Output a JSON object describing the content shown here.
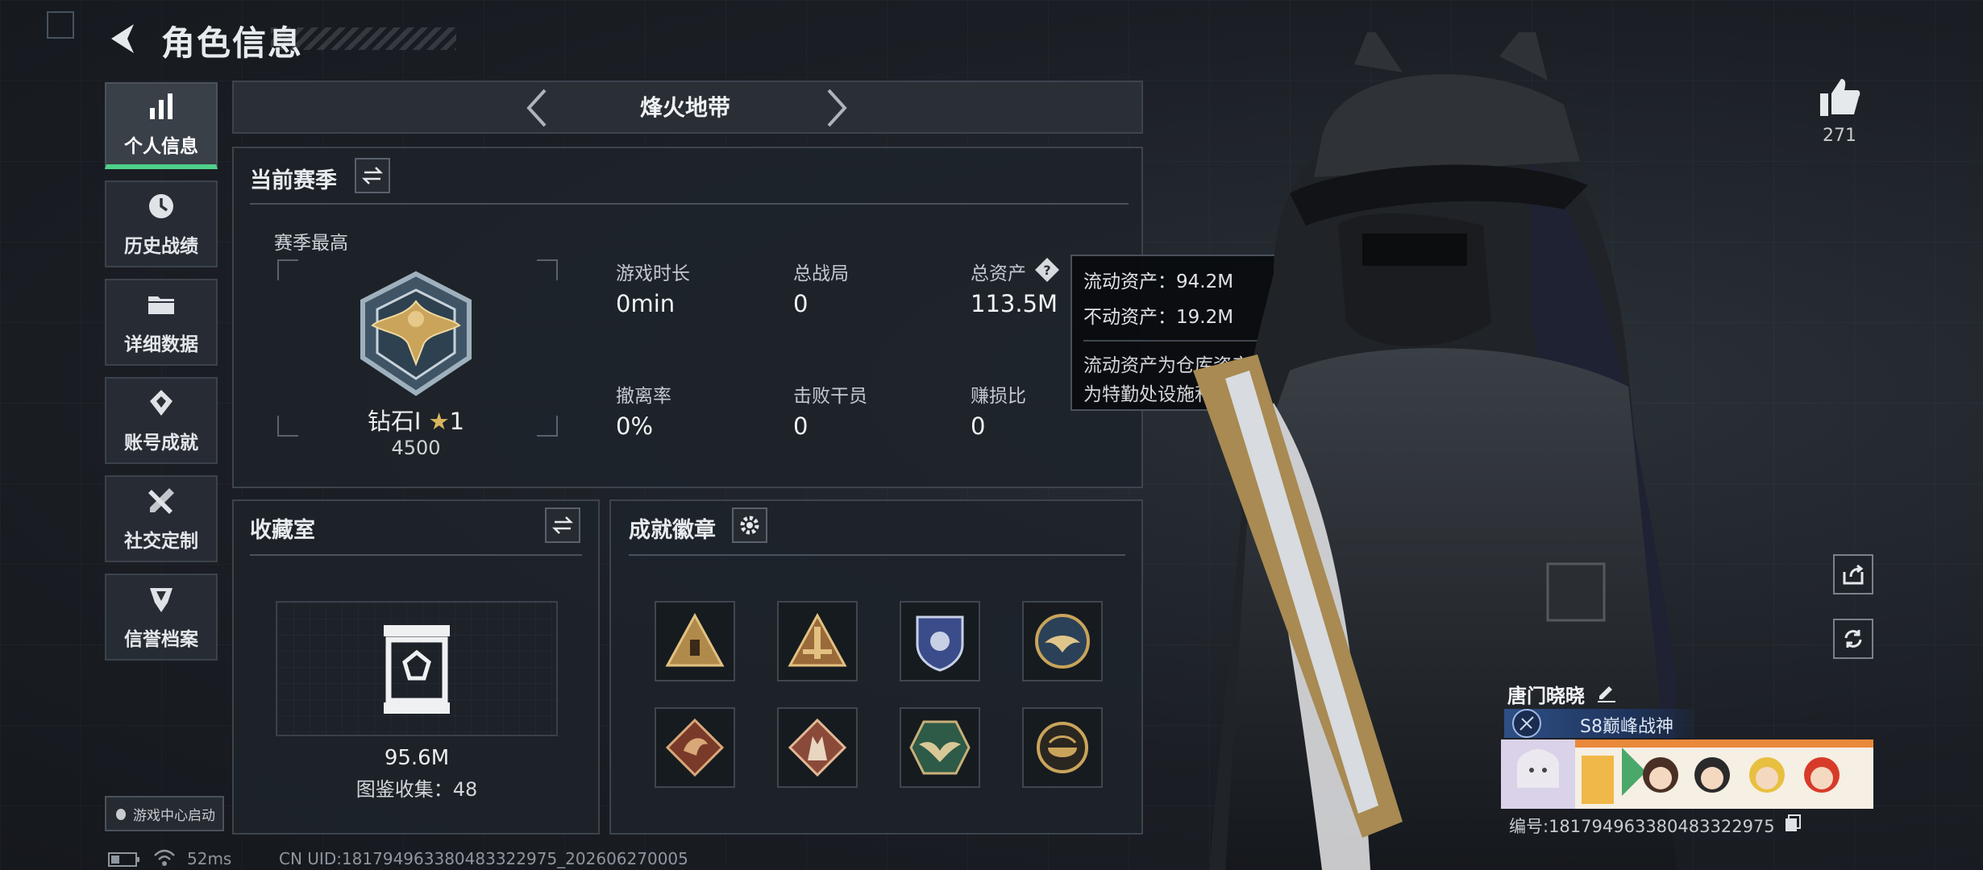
{
  "header": {
    "title": "角色信息"
  },
  "sidebar": {
    "items": [
      {
        "label": "个人信息",
        "icon": "bar-chart-icon",
        "active": true
      },
      {
        "label": "历史战绩",
        "icon": "history-icon"
      },
      {
        "label": "详细数据",
        "icon": "folder-icon"
      },
      {
        "label": "账号成就",
        "icon": "achievement-icon"
      },
      {
        "label": "社交定制",
        "icon": "tools-icon"
      },
      {
        "label": "信誉档案",
        "icon": "reputation-icon"
      }
    ],
    "game_center": "游戏中心启动"
  },
  "mode_tab": {
    "title": "烽火地带"
  },
  "season": {
    "title": "当前赛季",
    "best_label": "赛季最高",
    "rank_name": "钻石Ⅰ",
    "rank_stars": "1",
    "rank_points": "4500",
    "stats": [
      {
        "label": "游戏时长",
        "value": "0min"
      },
      {
        "label": "总战局",
        "value": "0"
      },
      {
        "label": "总资产",
        "value": "113.5M"
      },
      {
        "label": "撤离率",
        "value": "0%"
      },
      {
        "label": "击败干员",
        "value": "0"
      },
      {
        "label": "赚损比",
        "value": "0"
      }
    ]
  },
  "tooltip": {
    "liquid": "流动资产：94.2M",
    "fixed": "不动资产：19.2M",
    "note_line1": "流动资产为仓库资产和哈夫币，不动资产",
    "note_line2": "为特勤处设施和收藏室设施"
  },
  "collection": {
    "title": "收藏室",
    "value": "95.6M",
    "catalog": "图鉴收集：48"
  },
  "achievements": {
    "title": "成就徽章",
    "badges": [
      {
        "icon": "pyramid-badge-icon"
      },
      {
        "icon": "tower-badge-icon"
      },
      {
        "icon": "police-shield-badge-icon"
      },
      {
        "icon": "eagle-badge-icon"
      },
      {
        "icon": "dragon-badge-icon"
      },
      {
        "icon": "wolf-badge-icon"
      },
      {
        "icon": "wings-badge-icon"
      },
      {
        "icon": "bowl-badge-icon"
      }
    ]
  },
  "likes": {
    "count": "271"
  },
  "player": {
    "name": "唐门晓晓",
    "title_badge": "S8巅峰战神",
    "id_line": "编号:18179496338048332​2975"
  },
  "status": {
    "ping": "52ms",
    "uid": "CN UID:18179496338048332​2975_202606270005"
  },
  "colors": {
    "accent_green": "#4fd08a",
    "panel_bg": "#1e232a",
    "gold": "#c9a45a"
  }
}
